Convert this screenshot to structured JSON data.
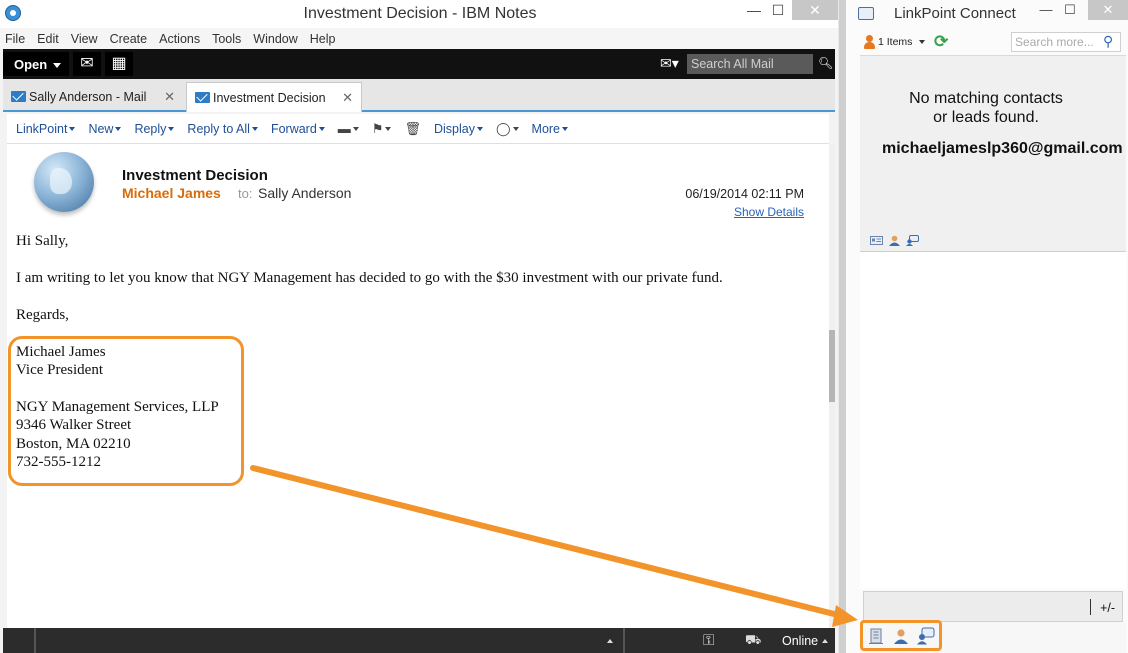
{
  "notes_window": {
    "title": "Investment Decision - IBM Notes",
    "controls": {
      "minimize": "—",
      "maximize": "☐",
      "close": "✕"
    },
    "menu": [
      "File",
      "Edit",
      "View",
      "Create",
      "Actions",
      "Tools",
      "Window",
      "Help"
    ],
    "toolbar": {
      "open_label": "Open",
      "search_placeholder": "Search All Mail"
    },
    "tabs": [
      {
        "label": "Sally Anderson - Mail",
        "close": "✕"
      },
      {
        "label": "Investment Decision",
        "close": "✕"
      }
    ],
    "actions": [
      "LinkPoint",
      "New",
      "Reply",
      "Reply to All",
      "Forward",
      "Display",
      "More"
    ],
    "message": {
      "subject": "Investment Decision",
      "from": "Michael James",
      "to_label": "to:",
      "to": "Sally Anderson",
      "date": "06/19/2014 02:11 PM",
      "show_details": "Show Details",
      "greeting": "Hi Sally,",
      "body": "I am writing to let you know that NGY Management has decided to go with the $30 investment with our private fund.",
      "closing": "Regards,",
      "signature": [
        "Michael James",
        "Vice President",
        "",
        "NGY Management Services, LLP",
        "9346 Walker Street",
        "Boston, MA 02210",
        "732-555-1212"
      ]
    },
    "status": {
      "online_label": "Online"
    }
  },
  "linkpoint_window": {
    "title": "LinkPoint Connect",
    "controls": {
      "minimize": "—",
      "maximize": "☐",
      "close": "✕"
    },
    "items_label": "1 Items",
    "search_placeholder": "Search more...",
    "no_match_line1": "No matching contacts",
    "no_match_line2": "or leads found.",
    "email": "michaeljameslp360@gmail.com",
    "plus_minus": "+/-"
  },
  "colors": {
    "highlight": "#f29429",
    "sender": "#d96c0a",
    "link": "#1e4f96",
    "tab_accent": "#4a97d6"
  }
}
